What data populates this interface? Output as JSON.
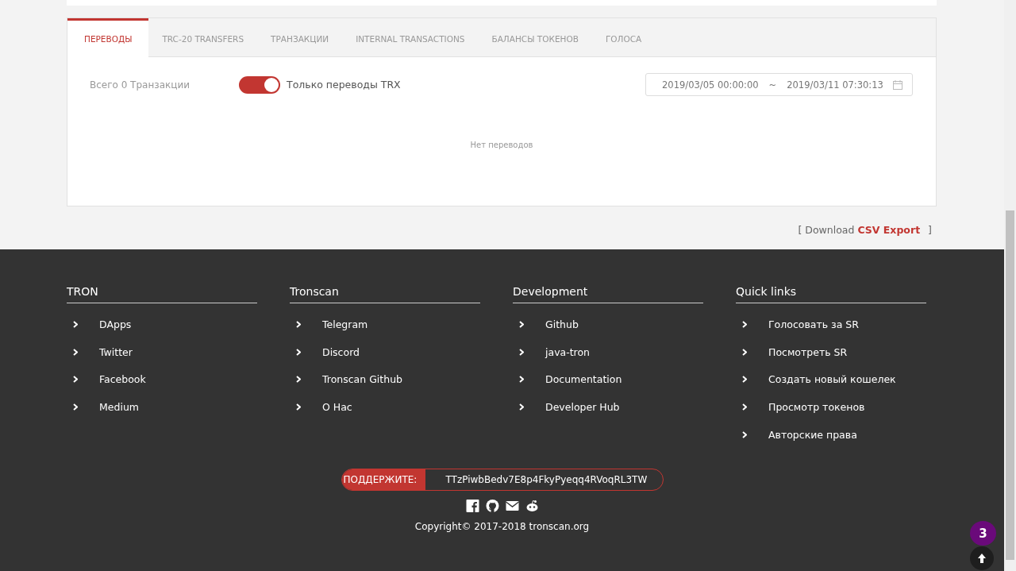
{
  "tabs": [
    {
      "label": "ПЕРЕВОДЫ",
      "selected": true
    },
    {
      "label": "TRC-20 TRANSFERS",
      "selected": false
    },
    {
      "label": "ТРАНЗАКЦИИ",
      "selected": false
    },
    {
      "label": "INTERNAL TRANSACTIONS",
      "selected": false
    },
    {
      "label": "БАЛАНСЫ ТОКЕНОВ",
      "selected": false
    },
    {
      "label": "ГОЛОСА",
      "selected": false
    }
  ],
  "filter": {
    "total": "Всего 0 Транзакции",
    "toggle": {
      "label": "Только переводы TRX",
      "on": true
    },
    "date_range": {
      "start": "2019/03/05 00:00:00",
      "separator": "~",
      "end": "2019/03/11 07:30:13"
    }
  },
  "empty_message": "Нет переводов",
  "export": {
    "open": "[",
    "prefix": "Download",
    "link": "CSV Export",
    "close": "]"
  },
  "footer": {
    "columns": [
      {
        "title": "TRON",
        "links": [
          "DApps",
          "Twitter",
          "Facebook",
          "Medium"
        ]
      },
      {
        "title": "Tronscan",
        "links": [
          "Telegram",
          "Discord",
          "Tronscan Github",
          "О Нас"
        ]
      },
      {
        "title": "Development",
        "links": [
          "Github",
          "java-tron",
          "Documentation",
          "Developer Hub"
        ]
      },
      {
        "title": "Quick links",
        "links": [
          "Голосовать за SR",
          "Посмотреть SR",
          "Создать новый кошелек",
          "Просмотр токенов",
          "Авторские права"
        ]
      }
    ],
    "donate": {
      "label": "ПОДДЕРЖИТЕ:",
      "address": "TTzPiwbBedv7E8p4FkyPyeqq4RVoqRL3TW"
    },
    "social": [
      {
        "kind": "facebook"
      },
      {
        "kind": "github"
      },
      {
        "kind": "mail"
      },
      {
        "kind": "reddit"
      }
    ],
    "copyright": "Copyright© 2017-2018 tronscan.org"
  },
  "notification_badge": "3"
}
